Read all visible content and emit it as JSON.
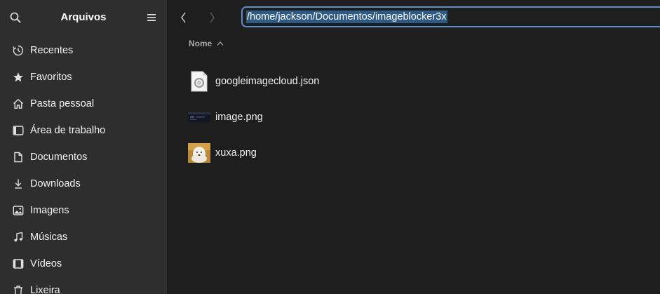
{
  "sidebar": {
    "title": "Arquivos",
    "items": [
      {
        "label": "Recentes",
        "icon": "clock-icon"
      },
      {
        "label": "Favoritos",
        "icon": "star-icon"
      },
      {
        "label": "Pasta pessoal",
        "icon": "home-icon"
      },
      {
        "label": "Área de trabalho",
        "icon": "desktop-icon"
      },
      {
        "label": "Documentos",
        "icon": "document-icon"
      },
      {
        "label": "Downloads",
        "icon": "download-icon"
      },
      {
        "label": "Imagens",
        "icon": "image-icon"
      },
      {
        "label": "Músicas",
        "icon": "music-icon"
      },
      {
        "label": "Vídeos",
        "icon": "video-icon"
      },
      {
        "label": "Lixeira",
        "icon": "trash-icon"
      }
    ]
  },
  "toolbar": {
    "path": "/home/jackson/Documentos/imageblocker3x"
  },
  "list": {
    "column_name": "Nome",
    "sort": "ascending",
    "files": [
      {
        "name": "googleimagecloud.json",
        "type": "json"
      },
      {
        "name": "image.png",
        "type": "png-dark"
      },
      {
        "name": "xuxa.png",
        "type": "png-photo"
      }
    ]
  },
  "colors": {
    "sidebar_bg": "#2e2e2e",
    "main_bg": "#1e1e1e",
    "accent": "#5a8ec9",
    "selection": "#2f5a86"
  }
}
